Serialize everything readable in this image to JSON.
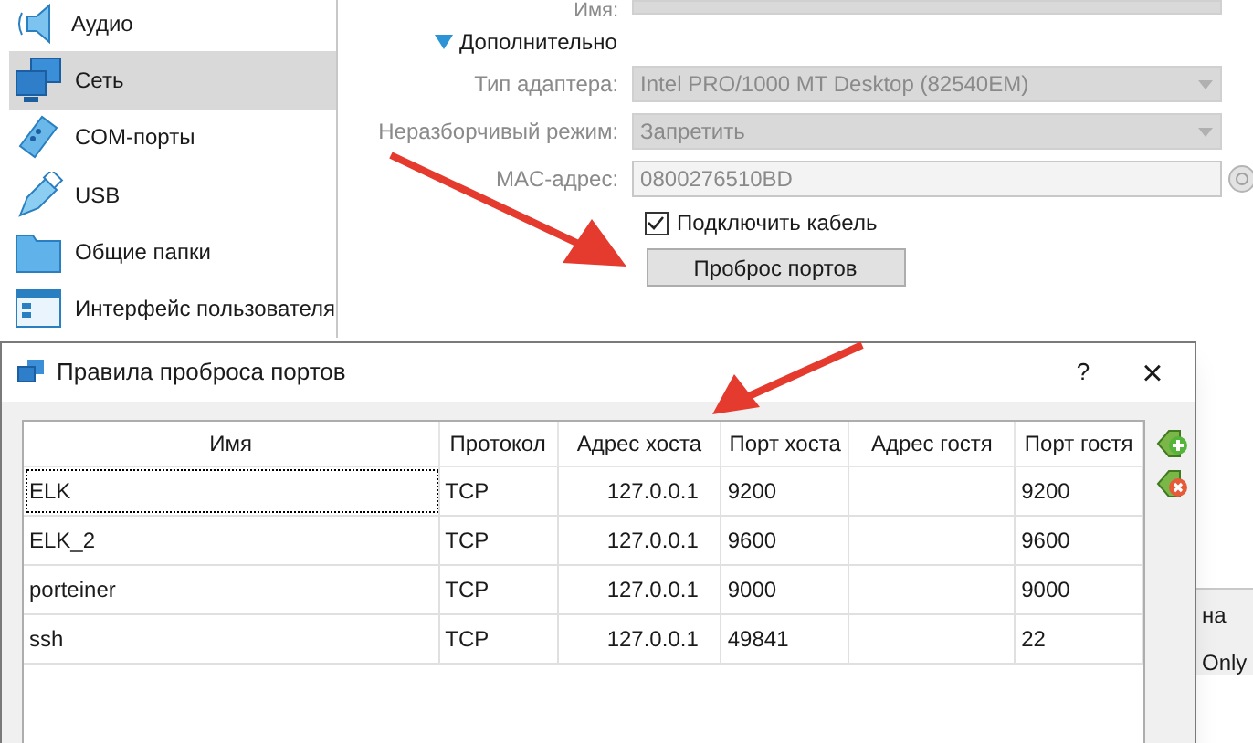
{
  "sidebar": {
    "items": [
      {
        "label": "Аудио",
        "selected": false
      },
      {
        "label": "Сеть",
        "selected": true
      },
      {
        "label": "COM-порты",
        "selected": false
      },
      {
        "label": "USB",
        "selected": false
      },
      {
        "label": "Общие папки",
        "selected": false
      },
      {
        "label": "Интерфейс пользователя",
        "selected": false
      }
    ]
  },
  "network": {
    "name_label": "Имя:",
    "advanced": {
      "label": "Дополнительно",
      "expanded": true
    },
    "adapter_type": {
      "label": "Тип адаптера:",
      "value": "Intel PRO/1000 MT Desktop (82540EM)"
    },
    "promiscuous": {
      "label": "Неразборчивый режим:",
      "value": "Запретить"
    },
    "mac": {
      "label": "MAC-адрес:",
      "value": "0800276510BD"
    },
    "cable": {
      "label": "Подключить кабель",
      "checked": true
    },
    "port_forwarding_button": "Проброс портов"
  },
  "dialog": {
    "title": "Правила проброса портов",
    "help": "?",
    "close": "×",
    "table": {
      "columns": [
        "Имя",
        "Протокол",
        "Адрес хоста",
        "Порт хоста",
        "Адрес гостя",
        "Порт гостя"
      ],
      "rows": [
        {
          "cells": [
            "ELK",
            "TCP",
            "127.0.0.1",
            "9200",
            "",
            "9200"
          ],
          "focused": true
        },
        {
          "cells": [
            "ELK_2",
            "TCP",
            "127.0.0.1",
            "9600",
            "",
            "9600"
          ],
          "focused": false
        },
        {
          "cells": [
            "porteiner",
            "TCP",
            "127.0.0.1",
            "9000",
            "",
            "9000"
          ],
          "focused": false
        },
        {
          "cells": [
            "ssh",
            "TCP",
            "127.0.0.1",
            "49841",
            "",
            "22"
          ],
          "focused": false
        }
      ]
    }
  },
  "background_window": {
    "texts": [
      "на",
      "Only"
    ]
  }
}
